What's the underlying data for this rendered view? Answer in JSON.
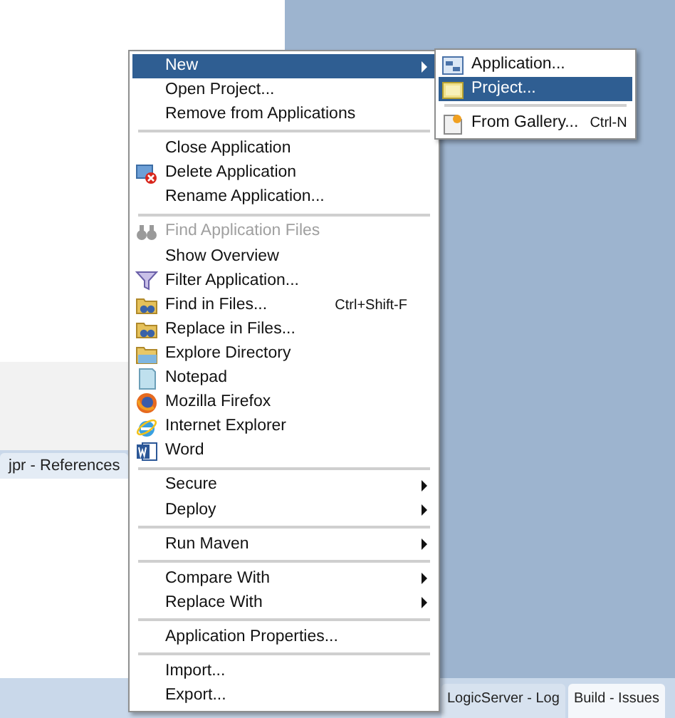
{
  "background": {
    "left_tab": "jpr - References",
    "bottom_tabs": [
      {
        "label": "LogicServer - Log",
        "selected": false
      },
      {
        "label": "Build - Issues",
        "selected": true
      }
    ]
  },
  "menu": {
    "items": [
      {
        "kind": "item",
        "label": "New",
        "selected": true,
        "submenu": true
      },
      {
        "kind": "item",
        "label": "Open Project..."
      },
      {
        "kind": "item",
        "label": "Remove from Applications"
      },
      {
        "kind": "separator"
      },
      {
        "kind": "item",
        "label": "Close Application"
      },
      {
        "kind": "item",
        "label": "Delete Application"
      },
      {
        "kind": "item",
        "label": "Rename Application..."
      },
      {
        "kind": "separator"
      },
      {
        "kind": "item",
        "label": "Find Application Files",
        "disabled": true
      },
      {
        "kind": "item",
        "label": "Show Overview"
      },
      {
        "kind": "item",
        "label": "Filter Application..."
      },
      {
        "kind": "item",
        "label": "Find in Files...",
        "shortcut": "Ctrl+Shift-F"
      },
      {
        "kind": "item",
        "label": "Replace in Files..."
      },
      {
        "kind": "item",
        "label": "Explore Directory"
      },
      {
        "kind": "item",
        "label": "Notepad"
      },
      {
        "kind": "item",
        "label": "Mozilla Firefox"
      },
      {
        "kind": "item",
        "label": "Internet Explorer"
      },
      {
        "kind": "item",
        "label": "Word"
      },
      {
        "kind": "separator"
      },
      {
        "kind": "item",
        "label": "Secure",
        "submenu": true
      },
      {
        "kind": "item",
        "label": "Deploy",
        "submenu": true
      },
      {
        "kind": "separator"
      },
      {
        "kind": "item",
        "label": "Run Maven",
        "submenu": true
      },
      {
        "kind": "separator"
      },
      {
        "kind": "item",
        "label": "Compare With",
        "submenu": true
      },
      {
        "kind": "item",
        "label": "Replace With",
        "submenu": true
      },
      {
        "kind": "separator"
      },
      {
        "kind": "item",
        "label": "Application Properties..."
      },
      {
        "kind": "separator"
      },
      {
        "kind": "item",
        "label": "Import..."
      },
      {
        "kind": "item",
        "label": "Export..."
      }
    ]
  },
  "submenu": {
    "items": [
      {
        "kind": "item",
        "label": "Application...",
        "selected": false
      },
      {
        "kind": "item",
        "label": "Project...",
        "selected": true
      },
      {
        "kind": "separator"
      },
      {
        "kind": "item",
        "label": "From Gallery...",
        "shortcut": "Ctrl-N",
        "selected": false
      }
    ]
  }
}
